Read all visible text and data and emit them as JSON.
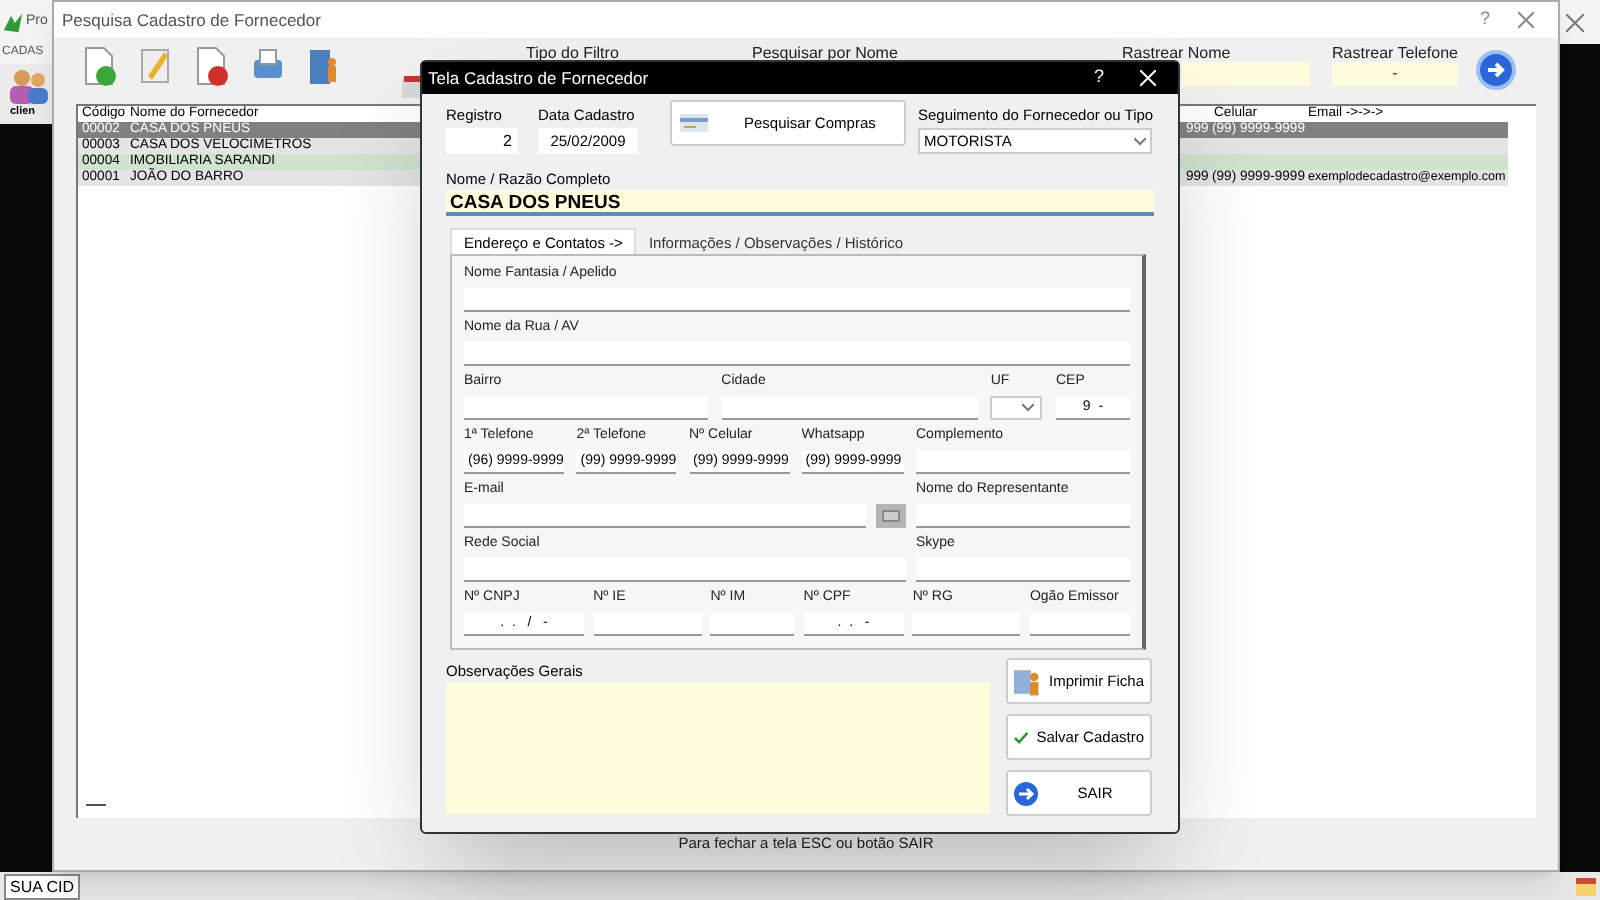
{
  "app": {
    "title": "Pro",
    "menu": "CADAS",
    "toolbar_label": "clien",
    "status_bar": "SUA CID"
  },
  "search_window": {
    "title": "Pesquisa Cadastro de Fornecedor",
    "help": "?",
    "filters": [
      {
        "label": "Tipo do Filtro"
      },
      {
        "label": "Pesquisar por Nome"
      },
      {
        "label": "Rastrear Nome"
      },
      {
        "label": "Rastrear Telefone",
        "value": "-"
      }
    ],
    "table": {
      "columns": [
        "Código",
        "Nome do Fornecedor",
        "Celular",
        "Email ->->->"
      ],
      "rows": [
        {
          "code": "00002",
          "name": "CASA DOS PNEUS",
          "column_3": "999",
          "celular": "(99) 9999-9999",
          "selected": true,
          "color": "#808080"
        },
        {
          "code": "00003",
          "name": "CASA DOS VELOCIMETROS",
          "selected": false,
          "color": "#e4e4e4"
        },
        {
          "code": "00004",
          "name": "IMOBILIARIA SARANDI",
          "selected": false,
          "color": "#cfe3cf"
        },
        {
          "code": "00001",
          "name": "JOÃO DO BARRO",
          "column_3": "999",
          "celular": "(99) 9999-9999",
          "email": "exemplodecadastro@exemplo.com",
          "selected": false,
          "color": "#e4e4e4"
        }
      ]
    },
    "footer_hint": "Para fechar a tela ESC ou botão SAIR"
  },
  "dialog": {
    "title": "Tela Cadastro de Fornecedor",
    "help": "?",
    "registro": {
      "label": "Registro",
      "value": "2"
    },
    "data_cadastro": {
      "label": "Data Cadastro",
      "value": "25/02/2009"
    },
    "search_purchases": "Pesquisar Compras",
    "segment": {
      "label": "Seguimento do Fornecedor ou Tipo",
      "value": "MOTORISTA"
    },
    "name": {
      "label": "Nome / Razão Completo",
      "value": "CASA DOS PNEUS"
    },
    "tabs": [
      {
        "label": "Endereço e Contatos ->",
        "selected": true
      },
      {
        "label": "Informações / Observações / Histórico",
        "selected": false
      }
    ],
    "field_rows": [
      [
        {
          "label": "Nome Fantasia / Apelido",
          "kind": "text"
        }
      ],
      [
        {
          "label": "Nome da Rua / AV",
          "kind": "text"
        }
      ],
      [
        {
          "label": "Bairro",
          "kind": "text"
        },
        {
          "label": "Cidade",
          "kind": "text"
        },
        {
          "label": "UF",
          "kind": "select"
        },
        {
          "label": "CEP",
          "value": "9  -",
          "kind": "text"
        }
      ],
      [
        {
          "label": "1ª Telefone",
          "value": "(96) 9999-9999",
          "kind": "text"
        },
        {
          "label": "2ª Telefone",
          "value": "(99) 9999-9999",
          "kind": "text"
        },
        {
          "label": "Nº Celular",
          "value": "(99) 9999-9999",
          "kind": "text"
        },
        {
          "label": "Whatsapp",
          "value": "(99) 9999-9999",
          "kind": "text"
        },
        {
          "label": "Complemento",
          "kind": "text"
        }
      ],
      [
        {
          "label": "E-mail",
          "kind": "email"
        },
        {
          "label": "Nome do Representante",
          "kind": "text"
        }
      ],
      [
        {
          "label": "Rede Social",
          "kind": "text"
        },
        {
          "label": "Skype",
          "kind": "text"
        }
      ],
      [
        {
          "label": "Nº CNPJ",
          "value": ".  .   /   -",
          "kind": "text"
        },
        {
          "label": "Nº IE",
          "kind": "text"
        },
        {
          "label": "Nº IM",
          "kind": "text"
        },
        {
          "label": "Nº CPF",
          "value": ".  .   -",
          "kind": "text"
        },
        {
          "label": "Nº RG",
          "kind": "text"
        },
        {
          "label": "Ogão Emissor",
          "kind": "text"
        }
      ]
    ],
    "notes_label": "Observações Gerais",
    "buttons": [
      {
        "label": "Imprimir Ficha",
        "kind": "print"
      },
      {
        "label": "Salvar Cadastro",
        "kind": "save"
      },
      {
        "label": "SAIR",
        "kind": "exit"
      }
    ]
  }
}
